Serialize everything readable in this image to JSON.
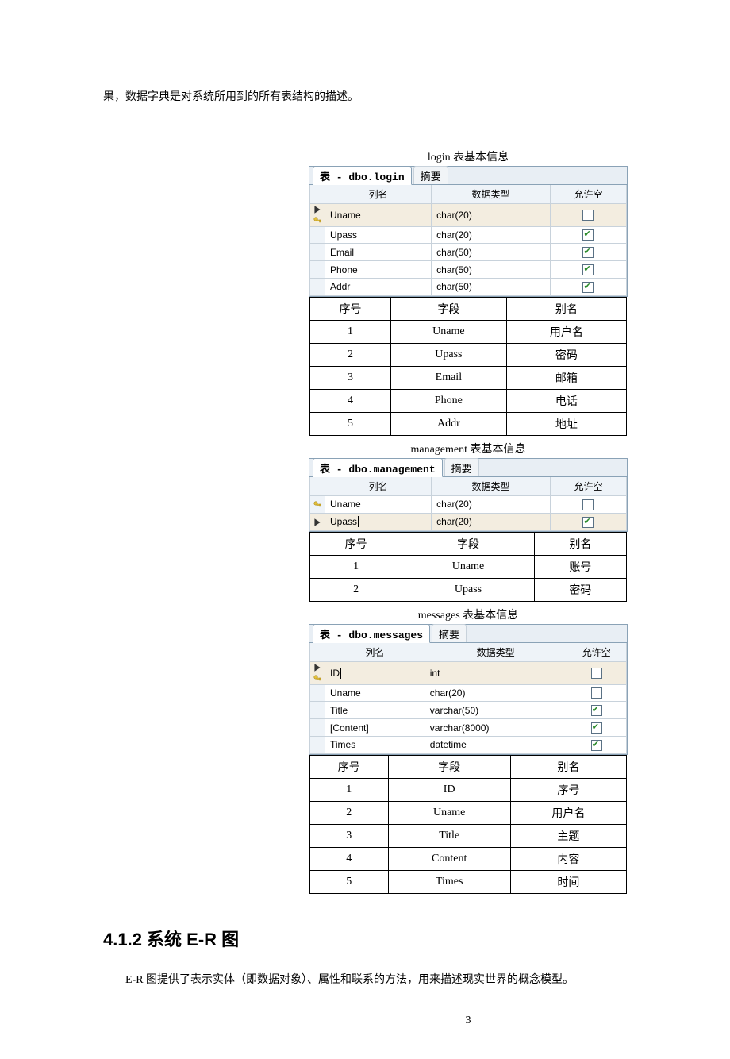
{
  "intro_line": "果，数据字典是对系统所用到的所有表结构的描述。",
  "section_heading": "4.1.2 系统 E-R 图",
  "er_paragraph": "E-R 图提供了表示实体（即数据对象）、属性和联系的方法，用来描述现实世界的概念模型。",
  "page_number": "3",
  "tab_summary_label": "摘要",
  "grid_headers": {
    "col": "列名",
    "type": "数据类型",
    "null": "允许空"
  },
  "alias_headers": {
    "num": "序号",
    "field": "字段",
    "alias": "别名"
  },
  "tables": [
    {
      "caption": "login 表基本信息",
      "tab_title": "表 - dbo.login",
      "columns": [
        {
          "mark": "pk-sel",
          "name": "Uname",
          "type": "char(20)",
          "nullable": false
        },
        {
          "mark": "",
          "name": "Upass",
          "type": "char(20)",
          "nullable": true
        },
        {
          "mark": "",
          "name": "Email",
          "type": "char(50)",
          "nullable": true
        },
        {
          "mark": "",
          "name": "Phone",
          "type": "char(50)",
          "nullable": true
        },
        {
          "mark": "",
          "name": "Addr",
          "type": "char(50)",
          "nullable": true
        }
      ],
      "aliases": [
        {
          "n": "1",
          "f": "Uname",
          "a": "用户名"
        },
        {
          "n": "2",
          "f": "Upass",
          "a": "密码"
        },
        {
          "n": "3",
          "f": "Email",
          "a": "邮箱"
        },
        {
          "n": "4",
          "f": "Phone",
          "a": "电话"
        },
        {
          "n": "5",
          "f": "Addr",
          "a": "地址"
        }
      ]
    },
    {
      "caption": "management 表基本信息",
      "tab_title": "表 - dbo.management",
      "columns": [
        {
          "mark": "pk",
          "name": "Uname",
          "type": "char(20)",
          "nullable": false
        },
        {
          "mark": "sel",
          "name": "Upass|",
          "type": "char(20)",
          "nullable": true
        }
      ],
      "aliases": [
        {
          "n": "1",
          "f": "Uname",
          "a": "账号"
        },
        {
          "n": "2",
          "f": "Upass",
          "a": "密码"
        }
      ]
    },
    {
      "caption": "messages 表基本信息",
      "tab_title": "表 - dbo.messages",
      "columns": [
        {
          "mark": "pk-sel",
          "name": "ID|",
          "type": "int",
          "nullable": false
        },
        {
          "mark": "",
          "name": "Uname",
          "type": "char(20)",
          "nullable": false
        },
        {
          "mark": "",
          "name": "Title",
          "type": "varchar(50)",
          "nullable": true
        },
        {
          "mark": "",
          "name": "[Content]",
          "type": "varchar(8000)",
          "nullable": true
        },
        {
          "mark": "",
          "name": "Times",
          "type": "datetime",
          "nullable": true
        }
      ],
      "aliases": [
        {
          "n": "1",
          "f": "ID",
          "a": "序号"
        },
        {
          "n": "2",
          "f": "Uname",
          "a": "用户名"
        },
        {
          "n": "3",
          "f": "Title",
          "a": "主题"
        },
        {
          "n": "4",
          "f": "Content",
          "a": "内容"
        },
        {
          "n": "5",
          "f": "Times",
          "a": "时间"
        }
      ]
    }
  ]
}
